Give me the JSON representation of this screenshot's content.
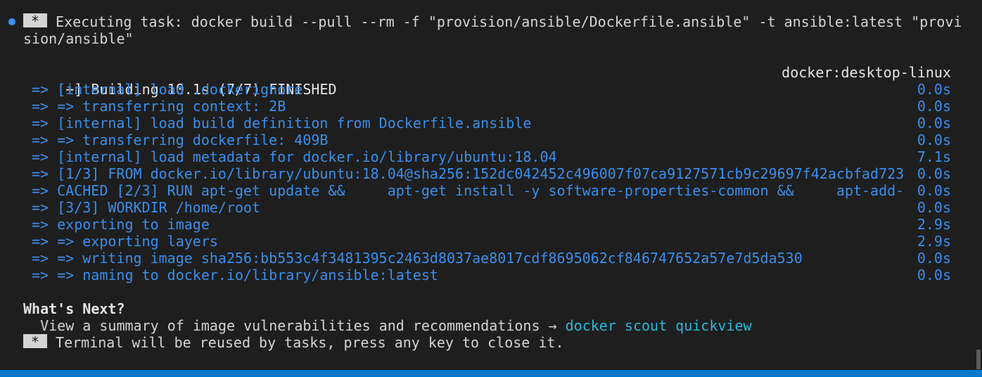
{
  "task": {
    "star": "*",
    "line1": "Executing task: docker build --pull --rm -f \"provision/ansible/Dockerfile.ansible\" -t ansible:latest \"provi",
    "line2": "sion/ansible\""
  },
  "build": {
    "header": "[+] Building 10.1s (7/7) FINISHED",
    "context": "docker:desktop-linux",
    "steps": [
      {
        "text": "=> [internal] load .dockerignore",
        "time": "0.0s"
      },
      {
        "text": "=> => transferring context: 2B",
        "time": "0.0s"
      },
      {
        "text": "=> [internal] load build definition from Dockerfile.ansible",
        "time": "0.0s"
      },
      {
        "text": "=> => transferring dockerfile: 409B",
        "time": "0.0s"
      },
      {
        "text": "=> [internal] load metadata for docker.io/library/ubuntu:18.04",
        "time": "7.1s"
      },
      {
        "text": "=> [1/3] FROM docker.io/library/ubuntu:18.04@sha256:152dc042452c496007f07ca9127571cb9c29697f42acbfad723",
        "time": "0.0s"
      },
      {
        "text": "=> CACHED [2/3] RUN apt-get update &&     apt-get install -y software-properties-common &&     apt-add-",
        "time": "0.0s"
      },
      {
        "text": "=> [3/3] WORKDIR /home/root",
        "time": "0.0s"
      },
      {
        "text": "=> exporting to image",
        "time": "2.9s"
      },
      {
        "text": "=> => exporting layers",
        "time": "2.9s"
      },
      {
        "text": "=> => writing image sha256:bb553c4f3481395c2463d8037ae8017cdf8695062cf846747652a57e7d5da530",
        "time": "0.0s"
      },
      {
        "text": "=> => naming to docker.io/library/ansible:latest",
        "time": "0.0s"
      }
    ]
  },
  "next": {
    "heading": "What's Next?",
    "summary_text": "  View a summary of image vulnerabilities and recommendations → ",
    "command": "docker scout quickview"
  },
  "footer": {
    "star": "*",
    "message": "Terminal will be reused by tasks, press any key to close it."
  },
  "colors": {
    "background": "#1e1e1e",
    "blue_text": "#3b8eea",
    "cyan_text": "#29b8db",
    "status_bar": "#007acc"
  }
}
